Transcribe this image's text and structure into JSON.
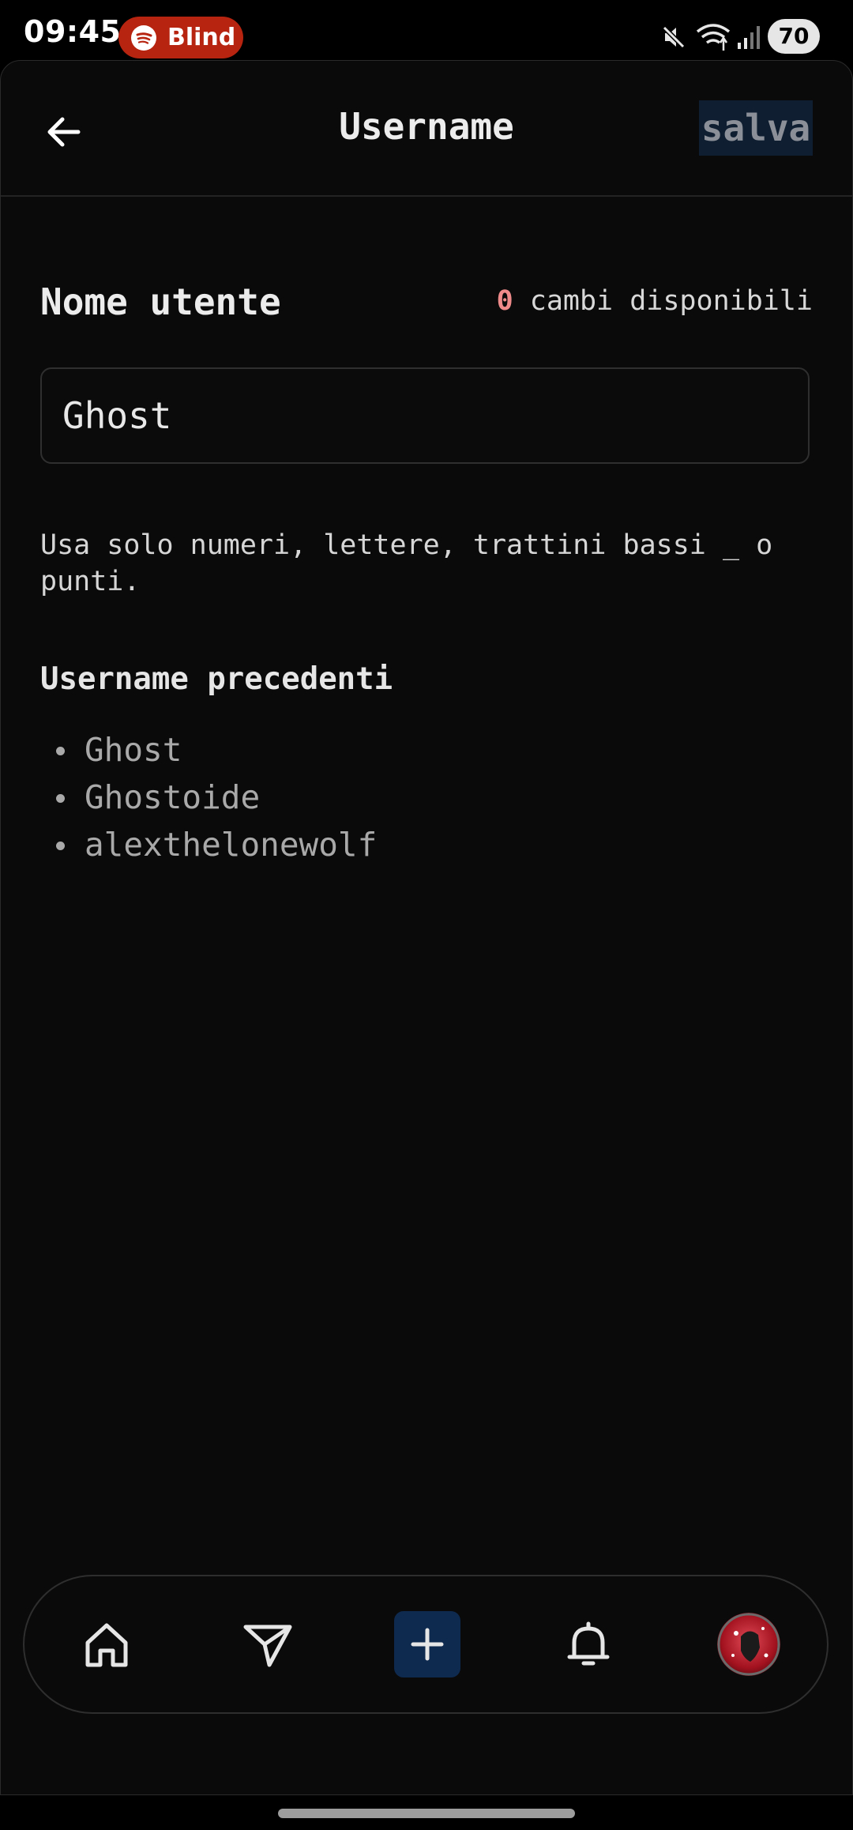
{
  "status_bar": {
    "time": "09:45",
    "spotify_label": "Blind",
    "battery": "70",
    "icons": [
      "mute-icon",
      "wifi-icon",
      "signal-icon",
      "battery-icon"
    ]
  },
  "header": {
    "title": "Username",
    "save_label": "salva",
    "back_icon": "arrow-left-icon"
  },
  "form": {
    "label": "Nome utente",
    "changes_count": "0",
    "changes_text": " cambi disponibili",
    "input_value": "Ghost",
    "hint": "Usa solo numeri, lettere, trattini bassi _ o punti."
  },
  "previous": {
    "title": "Username precedenti",
    "items": [
      "Ghost",
      "Ghostoide",
      "alexthelonewolf"
    ]
  },
  "bottom_nav": {
    "items": [
      "home-icon",
      "send-icon",
      "plus-icon",
      "bell-icon",
      "avatar"
    ]
  },
  "colors": {
    "background": "#0a0a0a",
    "accent_blue": "#0f2a4f",
    "spotify_red": "#b7240f",
    "count_red": "#ef8a8a"
  }
}
